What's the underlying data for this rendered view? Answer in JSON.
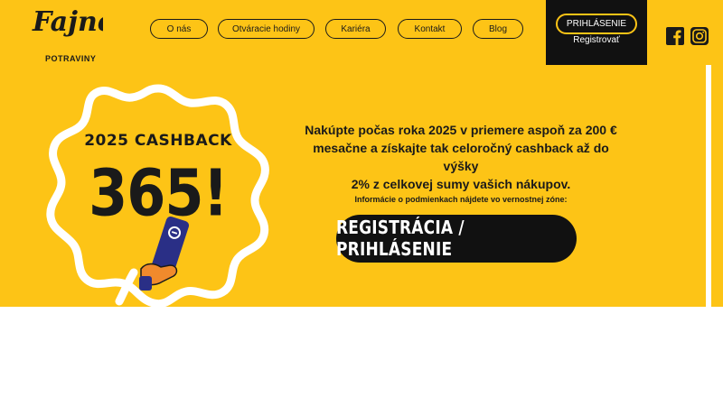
{
  "brand": {
    "logo_text": "Fajne",
    "tagline": "POTRAVINY"
  },
  "nav": {
    "items": [
      {
        "label": "O nás"
      },
      {
        "label": "Otváracie hodiny"
      },
      {
        "label": "Kariéra"
      },
      {
        "label": "Kontakt"
      },
      {
        "label": "Blog"
      }
    ]
  },
  "account": {
    "login_label": "PRIHLÁSENIE",
    "register_label": "Registrovať"
  },
  "social": {
    "facebook_icon": "facebook-icon",
    "instagram_icon": "instagram-icon"
  },
  "hero": {
    "badge_title": "2025 CASHBACK",
    "badge_number": "365!",
    "promo_lines": [
      "Nakúpte počas roka 2025 v priemere aspoň za 200 €",
      "mesačne a získajte tak celoročný cashback až do výšky",
      "2% z celkovej sumy vašich nákupov."
    ],
    "note": "Informácie o podmienkach nájdete vo vernostnej zóne:",
    "cta_label": "REGISTRÁCIA / PRIHLÁSENIE"
  },
  "colors": {
    "brand_yellow": "#fdc416",
    "dark": "#111111",
    "card_blue": "#2a2f86",
    "hand_orange": "#f08a2c"
  }
}
